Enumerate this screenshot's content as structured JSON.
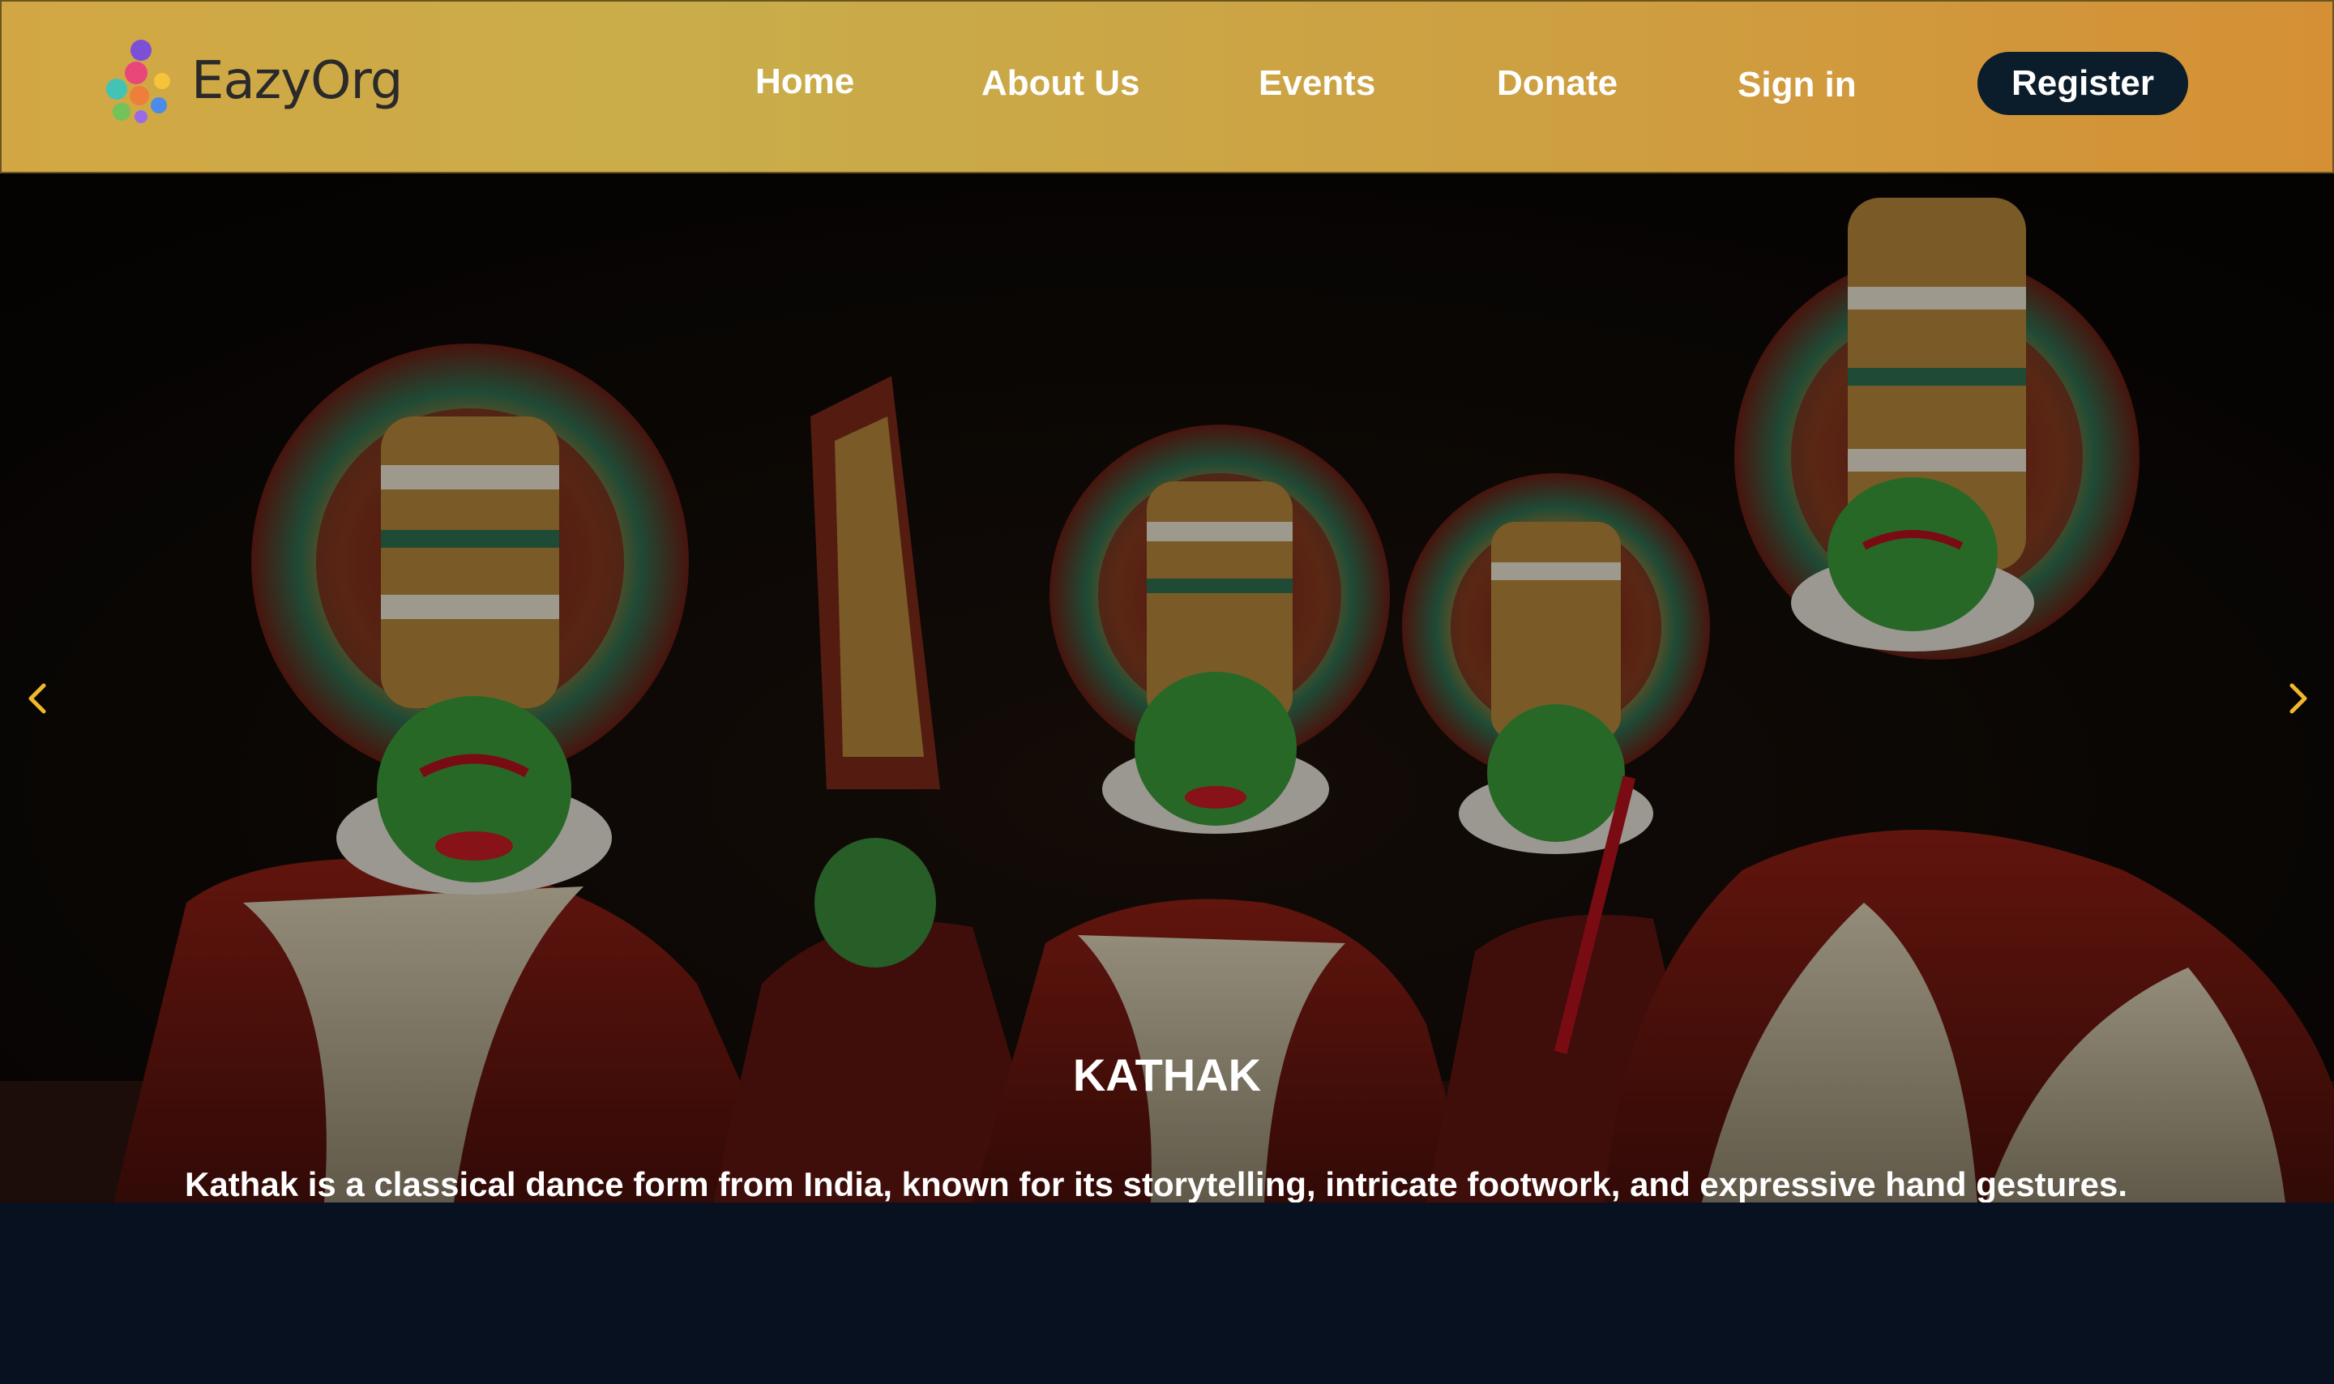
{
  "brand": {
    "name": "EazyOrg"
  },
  "nav": {
    "items": [
      {
        "label": "Home"
      },
      {
        "label": "About Us"
      },
      {
        "label": "Events"
      },
      {
        "label": "Donate"
      },
      {
        "label": "Sign in"
      }
    ],
    "register_label": "Register"
  },
  "carousel": {
    "title": "KATHAK",
    "description": "Kathak is a classical dance form from India, known for its storytelling, intricate footwork, and expressive hand gestures. Dancers wear ghungroo bells, and the dance is divided into Nritta (pure dance) and Abhinaya (expressive dance).",
    "slide_count": 3,
    "active_slide": 2,
    "prev_icon": "chevron-left-icon",
    "next_icon": "chevron-right-icon"
  },
  "colors": {
    "header_gradient_start": "#d2a743",
    "header_gradient_end": "#d59035",
    "register_bg": "#0b1d2a",
    "accent": "#f2b82c",
    "page_bg": "#07111f"
  }
}
